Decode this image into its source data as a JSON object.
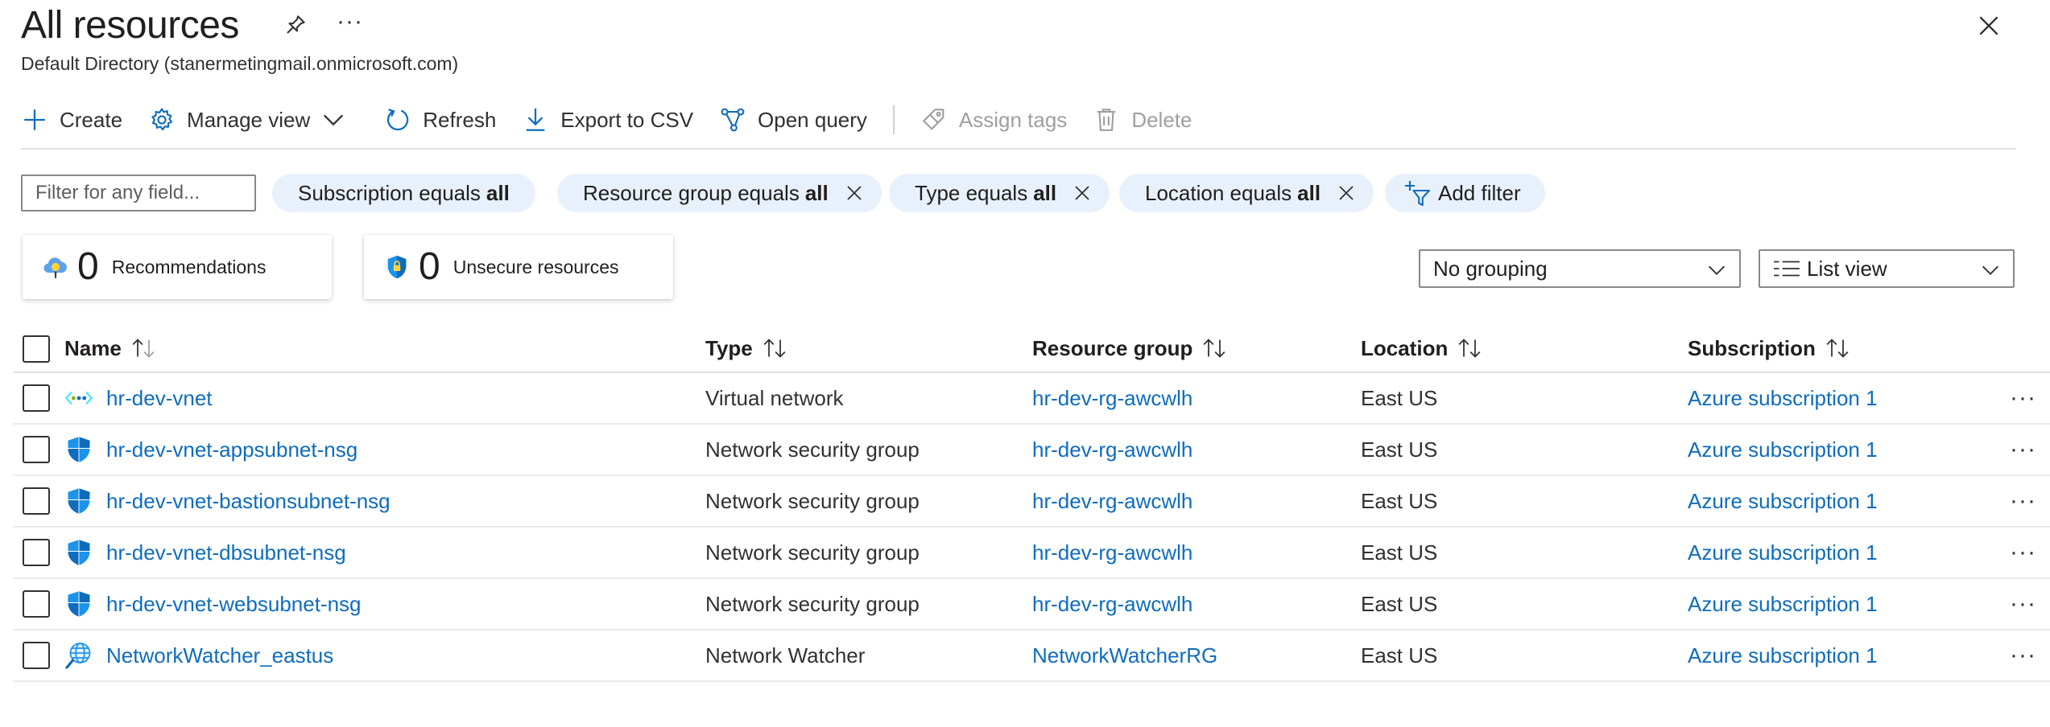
{
  "header": {
    "title": "All resources",
    "more": "···",
    "subtitle": "Default Directory (stanermetingmail.onmicrosoft.com)"
  },
  "toolbar": {
    "create": "Create",
    "manage_view": "Manage view",
    "refresh": "Refresh",
    "export": "Export to CSV",
    "open_query": "Open query",
    "assign_tags": "Assign tags",
    "delete": "Delete"
  },
  "filters": {
    "placeholder": "Filter for any field...",
    "pills": [
      {
        "label": "Subscription equals",
        "value": "all"
      },
      {
        "label": "Resource group equals",
        "value": "all"
      },
      {
        "label": "Type equals",
        "value": "all"
      },
      {
        "label": "Location equals",
        "value": "all"
      }
    ],
    "add_filter": "Add filter"
  },
  "cards": {
    "recommendations": {
      "count": "0",
      "label": "Recommendations"
    },
    "unsecure": {
      "count": "0",
      "label": "Unsecure resources"
    }
  },
  "grouping": {
    "selected": "No grouping"
  },
  "view": {
    "selected": "List view"
  },
  "table": {
    "columns": {
      "name": "Name",
      "type": "Type",
      "resource_group": "Resource group",
      "location": "Location",
      "subscription": "Subscription"
    },
    "rows": [
      {
        "name": "hr-dev-vnet",
        "icon": "vnet-icon",
        "type": "Virtual network",
        "resource_group": "hr-dev-rg-awcwlh",
        "location": "East US",
        "subscription": "Azure subscription 1"
      },
      {
        "name": "hr-dev-vnet-appsubnet-nsg",
        "icon": "nsg-shield-icon",
        "type": "Network security group",
        "resource_group": "hr-dev-rg-awcwlh",
        "location": "East US",
        "subscription": "Azure subscription 1"
      },
      {
        "name": "hr-dev-vnet-bastionsubnet-nsg",
        "icon": "nsg-shield-icon",
        "type": "Network security group",
        "resource_group": "hr-dev-rg-awcwlh",
        "location": "East US",
        "subscription": "Azure subscription 1"
      },
      {
        "name": "hr-dev-vnet-dbsubnet-nsg",
        "icon": "nsg-shield-icon",
        "type": "Network security group",
        "resource_group": "hr-dev-rg-awcwlh",
        "location": "East US",
        "subscription": "Azure subscription 1"
      },
      {
        "name": "hr-dev-vnet-websubnet-nsg",
        "icon": "nsg-shield-icon",
        "type": "Network security group",
        "resource_group": "hr-dev-rg-awcwlh",
        "location": "East US",
        "subscription": "Azure subscription 1"
      },
      {
        "name": "NetworkWatcher_eastus",
        "icon": "network-watcher-icon",
        "type": "Network Watcher",
        "resource_group": "NetworkWatcherRG",
        "location": "East US",
        "subscription": "Azure subscription 1"
      }
    ],
    "row_more": "···"
  },
  "colors": {
    "accent": "#0f6cbd",
    "pill_bg": "#e8f1fb",
    "border": "#8a8886"
  }
}
